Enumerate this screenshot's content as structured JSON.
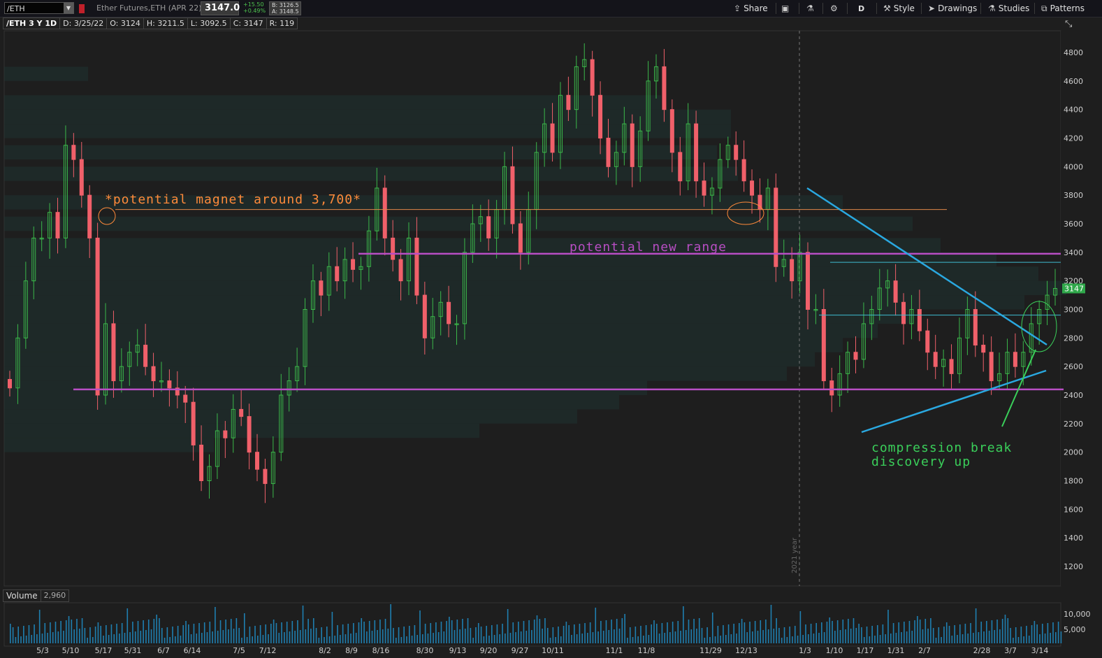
{
  "toolbar": {
    "symbol": "/ETH",
    "description": "Ether Futures,ETH (APR 22)",
    "last_price": "3147.0",
    "change": "+15.50",
    "change_pct": "+0.49%",
    "bid": "B: 3126.5",
    "ask": "A: 3148.5",
    "share_label": "Share",
    "period_label": "D",
    "style_label": "Style",
    "drawings_label": "Drawings",
    "studies_label": "Studies",
    "patterns_label": "Patterns"
  },
  "info": {
    "title": "/ETH 3 Y 1D",
    "date": "D: 3/25/22",
    "open": "O: 3124",
    "high": "H: 3211.5",
    "low": "L: 3092.5",
    "close": "C: 3147",
    "range": "R: 119"
  },
  "volume_panel": {
    "label": "Volume",
    "value": "2,960",
    "y_ticks": [
      "10,000",
      "5,000"
    ]
  },
  "chart_data": {
    "type": "candlestick",
    "ylim": [
      1100,
      4900
    ],
    "y_ticks": [
      "4800",
      "4600",
      "4400",
      "4200",
      "4000",
      "3800",
      "3600",
      "3400",
      "3200",
      "3000",
      "2800",
      "2600",
      "2400",
      "2200",
      "2000",
      "1800",
      "1600",
      "1400",
      "1200"
    ],
    "x_ticks": [
      "5/3",
      "5/10",
      "5/17",
      "5/31",
      "6/7",
      "6/14",
      "7/5",
      "7/12",
      "8/2",
      "8/9",
      "8/16",
      "8/30",
      "9/13",
      "9/20",
      "9/27",
      "10/11",
      "11/1",
      "11/8",
      "11/29",
      "12/13",
      "1/3",
      "1/10",
      "1/17",
      "1/31",
      "2/7",
      "2/28",
      "3/7",
      "3/14"
    ],
    "last_price_label": "3147",
    "year_divider_label": "2021 year",
    "closes": [
      2450,
      2800,
      3200,
      3500,
      3500,
      3680,
      3500,
      4150,
      4050,
      3800,
      3500,
      2400,
      2900,
      2500,
      2600,
      2700,
      2750,
      2600,
      2500,
      2500,
      2450,
      2400,
      2350,
      2050,
      1800,
      1900,
      2150,
      2100,
      2300,
      2250,
      2000,
      1880,
      1780,
      2000,
      2400,
      2500,
      2600,
      3000,
      3200,
      3100,
      3300,
      3200,
      3350,
      3280,
      3300,
      3550,
      3850,
      3500,
      3350,
      3200,
      3500,
      3100,
      2800,
      2950,
      3050,
      2900,
      2900,
      3400,
      3600,
      3650,
      3500,
      3700,
      4000,
      3600,
      3400,
      3700,
      4100,
      4300,
      4100,
      4500,
      4400,
      4700,
      4750,
      4500,
      4200,
      4000,
      4100,
      4300,
      4000,
      4250,
      4600,
      4700,
      4400,
      4100,
      3900,
      4300,
      3900,
      3800,
      3850,
      4050,
      4150,
      4050,
      3900,
      3800,
      3700,
      3850,
      3300,
      3350,
      3200,
      3400,
      3000,
      3000,
      2500,
      2400,
      2550,
      2700,
      2650,
      2900,
      3000,
      3150,
      3200,
      3050,
      2900,
      3000,
      2850,
      2700,
      2600,
      2650,
      2550,
      2800,
      3000,
      2750,
      2700,
      2500,
      2550,
      2700,
      2600,
      2700,
      2900,
      3000,
      3100,
      3147
    ],
    "annotations": [
      {
        "text": "*potential magnet around 3,700*",
        "price": 3700,
        "color": "#ff8a3a"
      },
      {
        "text": "potential new range",
        "price": 3390,
        "color": "#b84ec4"
      },
      {
        "text": "compression break",
        "price": null,
        "color": "#3acf5a"
      },
      {
        "text": "discovery up",
        "price": null,
        "color": "#3acf5a"
      }
    ],
    "levels": [
      {
        "price": 3700,
        "color": "#e0884a",
        "kind": "magnet"
      },
      {
        "price": 3390,
        "color": "#b84ec4",
        "kind": "range-top"
      },
      {
        "price": 2440,
        "color": "#b84ec4",
        "kind": "range-bottom"
      },
      {
        "price": 3330,
        "color": "#3fbcd0",
        "kind": "resistance"
      },
      {
        "price": 2960,
        "color": "#3fbcd0",
        "kind": "support"
      }
    ],
    "colors": {
      "up": "#3bb84a",
      "down": "#f0606a",
      "bg": "#1e1e1e",
      "trend": "#2aa8e0",
      "arrow": "#3acf5a"
    }
  }
}
